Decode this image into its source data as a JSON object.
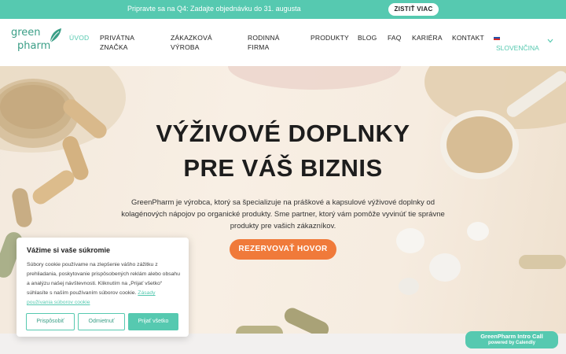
{
  "promo": {
    "text": "Pripravte sa na Q4: Zadajte objednávku do 31. augusta",
    "button": "ZISTIŤ VIAC"
  },
  "logo": {
    "line1": "green",
    "line2": "pharm"
  },
  "nav": {
    "items": [
      {
        "line1": "ÚVOD",
        "line2": ""
      },
      {
        "line1": "PRIVÁTNA",
        "line2": "ZNAČKA"
      },
      {
        "line1": "ZÁKAZKOVÁ",
        "line2": "VÝROBA"
      },
      {
        "line1": "RODINNÁ",
        "line2": "FIRMA"
      },
      {
        "line1": "PRODUKTY",
        "line2": ""
      },
      {
        "line1": "BLOG",
        "line2": ""
      },
      {
        "line1": "FAQ",
        "line2": ""
      },
      {
        "line1": "KARIÉRA",
        "line2": ""
      },
      {
        "line1": "KONTAKT",
        "line2": ""
      }
    ],
    "language": "SLOVENČINA",
    "accent": "#56c9b0"
  },
  "hero": {
    "title_line1": "VÝŽIVOVÉ DOPLNKY",
    "title_line2": "PRE VÁŠ BIZNIS",
    "description": "GreenPharm je výrobca, ktorý sa špecializuje na práškové a kapsulové výživové doplnky od kolagénových nápojov po organické produkty. Sme partner, ktorý vám pomôže vyvinúť tie správne produkty pre vašich zákazníkov.",
    "cta": "REZERVOVAŤ HOVOR",
    "cta_color": "#f07a3a"
  },
  "cookie": {
    "title": "Vážime si vaše súkromie",
    "text": "Súbory cookie používame na zlepšenie vášho zážitku z prehliadania, poskytovanie prispôsobených reklám alebo obsahu a analýzu našej návštevnosti. Kliknutím na „Prijať všetko“ súhlasíte s naším používaním súborov cookie.",
    "link": "Zásady používania súborov cookie",
    "btn_customize": "Prispôsobiť",
    "btn_reject": "Odmietnuť",
    "btn_accept": "Prijať všetko"
  },
  "calendly": {
    "title": "GreenPharm Intro Call",
    "subtitle": "powered by Calendly"
  }
}
